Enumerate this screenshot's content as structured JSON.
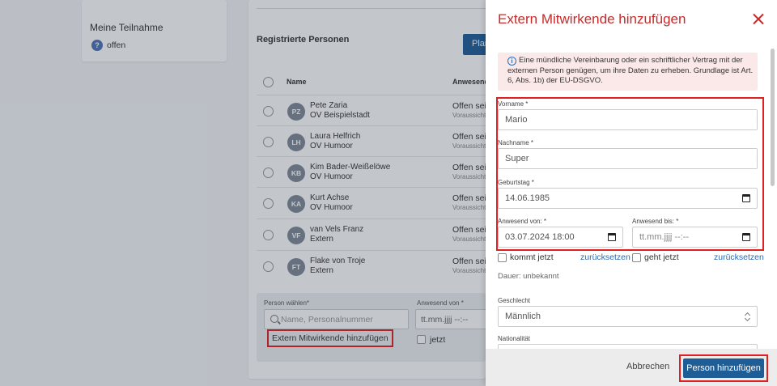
{
  "background": {
    "meine_teilnahme": {
      "title": "Meine Teilnahme",
      "icon": "question-icon",
      "icon_glyph": "?",
      "status": "offen"
    },
    "registered": {
      "title": "Registrierte Personen",
      "plan_button": "Plan",
      "headers": {
        "name": "Name",
        "anwesend": "Anwesend v"
      },
      "rows": [
        {
          "initials": "PZ",
          "name": "Pete Zaria",
          "org": "OV Beispielstadt",
          "status": "Offen seit",
          "sub": "Voraussicht"
        },
        {
          "initials": "LH",
          "name": "Laura Helfrich",
          "org": "OV Humoor",
          "status": "Offen seit",
          "sub": "Voraussicht"
        },
        {
          "initials": "KB",
          "name": "Kim Bader-Weißelöwe",
          "org": "OV Humoor",
          "status": "Offen seit",
          "sub": "Voraussicht"
        },
        {
          "initials": "KA",
          "name": "Kurt Achse",
          "org": "OV Humoor",
          "status": "Offen seit",
          "sub": "Voraussicht"
        },
        {
          "initials": "VF",
          "name": "van Vels Franz",
          "org": "Extern",
          "status": "Offen seit",
          "sub": "Voraussicht"
        },
        {
          "initials": "FT",
          "name": "Flake von Troje",
          "org": "Extern",
          "status": "Offen seit",
          "sub": "Voraussicht"
        }
      ]
    },
    "selection": {
      "person_label": "Person wählen*",
      "person_placeholder": "Name, Personalnummer",
      "anwesend_label": "Anwesend von *",
      "anwesend_placeholder": "tt.mm.jjjj --:--",
      "jetzt_label": "jetzt",
      "extern_link": "Extern Mitwirkende hinzufügen"
    }
  },
  "panel": {
    "title": "Extern Mitwirkende hinzufügen",
    "info_icon_glyph": "i",
    "info_text": "Eine mündliche Vereinbarung oder ein schriftlicher Vertrag mit der externen Person genügen, um ihre Daten zu erheben. Grundlage ist Art. 6, Abs. 1b) der EU-DSGVO.",
    "fields": {
      "vorname": {
        "label": "Vorname *",
        "value": "Mario"
      },
      "nachname": {
        "label": "Nachname *",
        "value": "Super"
      },
      "geburtstag": {
        "label": "Geburtstag *",
        "value": "14.06.1985"
      },
      "anwesend_von": {
        "label": "Anwesend von: *",
        "value": "03.07.2024 18:00"
      },
      "anwesend_bis": {
        "label": "Anwesend bis: *",
        "value": "tt.mm.jjjj --:--"
      }
    },
    "kommt_jetzt": "kommt jetzt",
    "geht_jetzt": "geht jetzt",
    "reset": "zurücksetzen",
    "dauer": "Dauer: unbekannt",
    "geschlecht": {
      "label": "Geschlecht",
      "value": "Männlich"
    },
    "nationalitaet": {
      "label": "Nationalität"
    },
    "cancel": "Abbrechen",
    "submit": "Person hinzufügen"
  },
  "colors": {
    "accent": "#1e5e97",
    "title_red": "#c52b2b",
    "highlight": "#e02020"
  }
}
